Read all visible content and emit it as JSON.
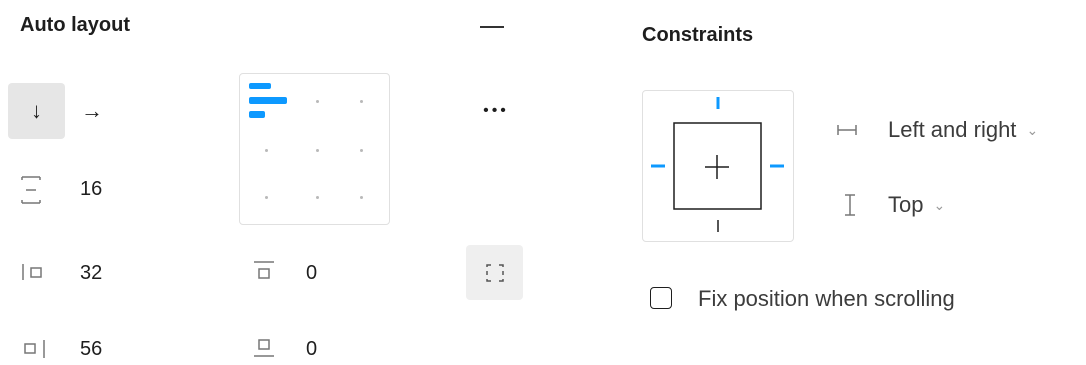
{
  "auto_layout": {
    "title": "Auto layout",
    "direction_vertical_icon": "↓",
    "direction_horizontal_icon": "→",
    "spacing_between": "16",
    "padding_left": "32",
    "padding_right": "56",
    "padding_top": "0",
    "padding_bottom": "0",
    "more_icon": "•••"
  },
  "constraints": {
    "title": "Constraints",
    "horizontal": "Left and right",
    "vertical": "Top"
  },
  "fix_position": {
    "label": "Fix position when scrolling",
    "checked": false
  },
  "colors": {
    "accent": "#0d99ff"
  }
}
